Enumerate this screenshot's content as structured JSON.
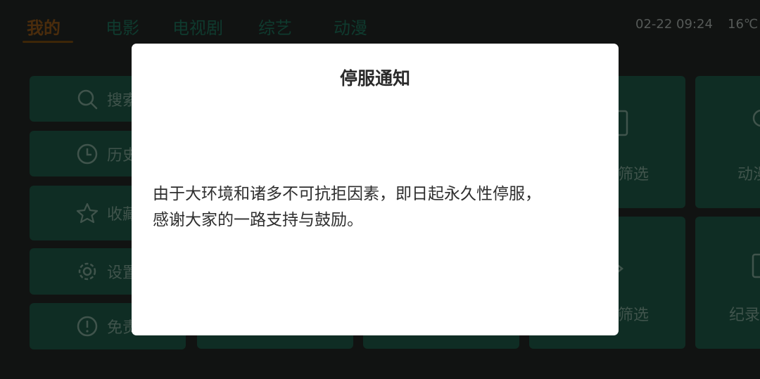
{
  "topnav": {
    "tabs": [
      {
        "label": "我的",
        "active": true
      },
      {
        "label": "电影",
        "active": false
      },
      {
        "label": "电视剧",
        "active": false
      },
      {
        "label": "综艺",
        "active": false
      },
      {
        "label": "动漫",
        "active": false
      }
    ],
    "datetime": "02-22 09:24",
    "temperature": "16℃"
  },
  "sidebar": {
    "items": [
      {
        "label": "搜索",
        "icon": "search-icon"
      },
      {
        "label": "历史",
        "icon": "clock-icon"
      },
      {
        "label": "收藏",
        "icon": "star-icon"
      },
      {
        "label": "设置",
        "icon": "gear-icon"
      },
      {
        "label": "免责",
        "icon": "info-icon"
      }
    ]
  },
  "grid": {
    "tiles": [
      {
        "label": "筛选",
        "icon": "tv-icon"
      },
      {
        "label": "动漫",
        "icon": "bulb-icon"
      },
      {
        "label": "筛选",
        "icon": "chevron-icon"
      },
      {
        "label": "纪录",
        "icon": "screen-icon"
      }
    ]
  },
  "modal": {
    "title": "停服通知",
    "body_line1": "由于大环境和诸多不可抗拒因素，即日起永久性停服，",
    "body_line2": "感谢大家的一路支持与鼓励。"
  },
  "colors": {
    "background": "#111312",
    "tile": "#0f2d24",
    "active_tab": "#4a2c0c",
    "modal_bg": "#ffffff"
  }
}
